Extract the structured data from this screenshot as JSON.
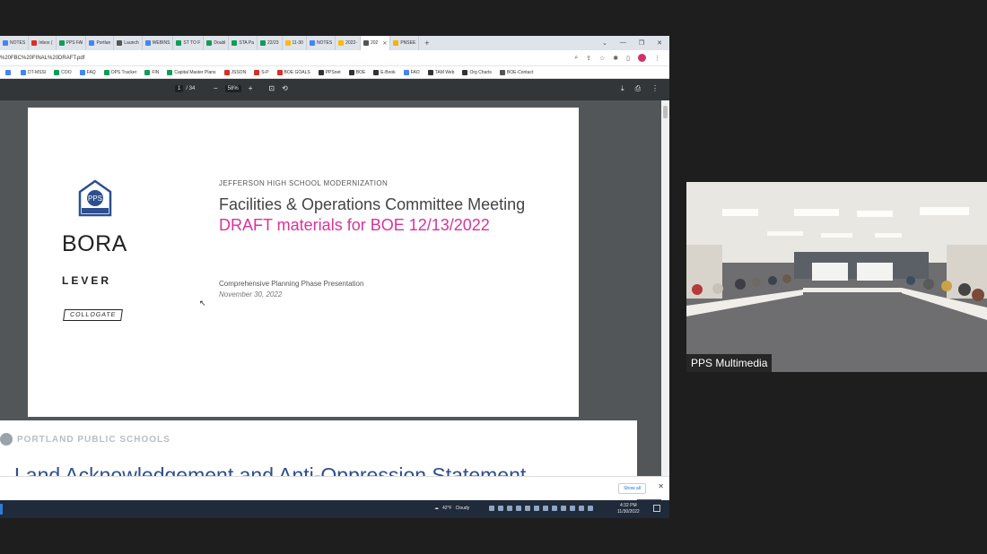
{
  "browser": {
    "tabs": [
      {
        "label": "NOTES",
        "color": "#4285f4",
        "active": false
      },
      {
        "label": "Inbox (",
        "color": "#d93025",
        "active": false
      },
      {
        "label": "PPS FAI",
        "color": "#0f9d58",
        "active": false
      },
      {
        "label": "Portlan",
        "color": "#4285f4",
        "active": false
      },
      {
        "label": "Launch",
        "color": "#555555",
        "active": false
      },
      {
        "label": "WEBINS",
        "color": "#4285f4",
        "active": false
      },
      {
        "label": "ST TO F",
        "color": "#0f9d58",
        "active": false
      },
      {
        "label": "Doubl",
        "color": "#0f9d58",
        "active": false
      },
      {
        "label": "STA Pa",
        "color": "#0f9d58",
        "active": false
      },
      {
        "label": "22/23",
        "color": "#0f9d58",
        "active": false
      },
      {
        "label": "11-30",
        "color": "#fbbc04",
        "active": false
      },
      {
        "label": "NOTES",
        "color": "#4285f4",
        "active": false
      },
      {
        "label": "2022-",
        "color": "#fbbc04",
        "active": false
      },
      {
        "label": "202",
        "color": "#555555",
        "active": true
      },
      {
        "label": "PNSEE",
        "color": "#f4b400",
        "active": false
      }
    ],
    "new_tab": "+",
    "url": "%20FBC%20FINAL%20DRAFT.pdf",
    "bookmarks": [
      {
        "label": "",
        "color": "#4285f4"
      },
      {
        "label": "DT-MSSI",
        "color": "#4285f4"
      },
      {
        "label": "COO",
        "color": "#0f9d58"
      },
      {
        "label": "FAQ",
        "color": "#4285f4"
      },
      {
        "label": "OPS Tracker",
        "color": "#0f9d58"
      },
      {
        "label": "FIN",
        "color": "#0f9d58"
      },
      {
        "label": "Capital Master Plans",
        "color": "#0f9d58"
      },
      {
        "label": "JSSON",
        "color": "#d93025"
      },
      {
        "label": "S-P",
        "color": "#d93025"
      },
      {
        "label": "BOE GOALS",
        "color": "#d93025"
      },
      {
        "label": "PPSnet",
        "color": "#333333"
      },
      {
        "label": "BOE",
        "color": "#333333"
      },
      {
        "label": "E-Book",
        "color": "#333333"
      },
      {
        "label": "FAO",
        "color": "#4285f4"
      },
      {
        "label": "TAM Web",
        "color": "#333333"
      },
      {
        "label": "Org Charts",
        "color": "#333333"
      },
      {
        "label": "BOE-Contact",
        "color": "#555555"
      }
    ]
  },
  "pdf_toolbar": {
    "current_page": "1",
    "total_pages": "/ 34",
    "zoom": "58%"
  },
  "slide1": {
    "logo_text": "PPS",
    "bora": "BORA",
    "lever": "LEVER",
    "collogate": "COLLOGATE",
    "project": "JEFFERSON HIGH SCHOOL MODERNIZATION",
    "title": "Facilities & Operations Committee Meeting",
    "draft": "DRAFT materials for BOE 12/13/2022",
    "subtitle": "Comprehensive Planning Phase Presentation",
    "date": "November 30, 2022"
  },
  "slide2": {
    "org": "PORTLAND PUBLIC SCHOOLS",
    "heading": "Land Acknowledgement and Anti-Oppression Statement"
  },
  "download_bar": {
    "show_all": "Show all"
  },
  "taskbar": {
    "temperature": "42°F",
    "weather": "Cloudy",
    "time": "4:32 PM",
    "date": "11/30/2022"
  },
  "video": {
    "participant": "PPS Multimedia"
  },
  "colors": {
    "accent_pink": "#d9339b",
    "pps_blue": "#2d4e8f",
    "taskbar": "#1f2a3a",
    "pdf_toolbar": "#323639"
  }
}
